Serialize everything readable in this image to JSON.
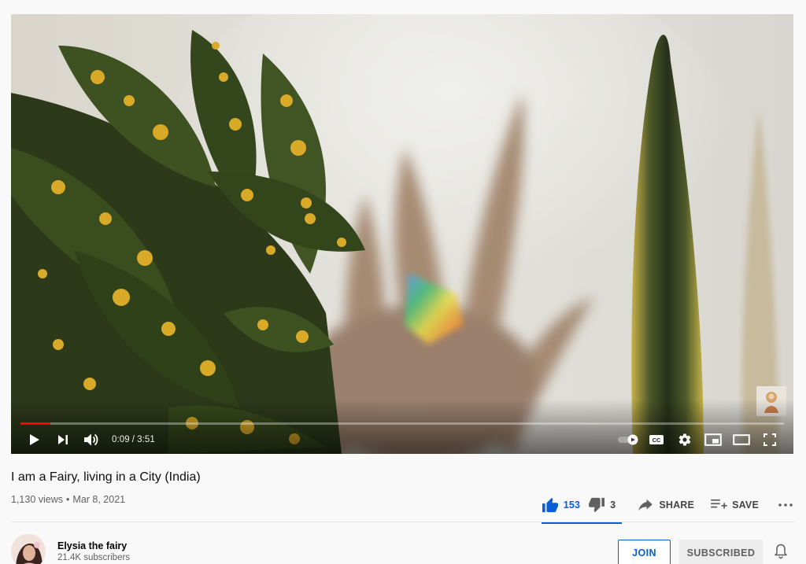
{
  "player": {
    "current_time": "0:09",
    "separator": "/",
    "duration": "3:51",
    "progress_played_fraction": 0.039,
    "progress_loaded_fraction": 0.039,
    "autoplay_on": true,
    "cc_label": "CC"
  },
  "icons": {
    "play": "play-icon",
    "next": "next-icon",
    "volume": "volume-icon",
    "autoplay": "autoplay-toggle-icon",
    "captions": "captions-icon",
    "settings": "gear-icon",
    "miniplayer": "miniplayer-icon",
    "theater": "theater-mode-icon",
    "fullscreen": "fullscreen-icon",
    "like": "thumbs-up-icon",
    "dislike": "thumbs-down-icon",
    "share": "share-icon",
    "save": "add-to-playlist-icon",
    "more": "more-horizontal-icon",
    "bell": "bell-icon"
  },
  "video": {
    "title": "I am a Fairy, living in a City (India)",
    "views": "1,130 views",
    "dot": "•",
    "date": "Mar 8, 2021"
  },
  "actions": {
    "like_count": "153",
    "dislike_count": "3",
    "share_label": "SHARE",
    "save_label": "SAVE"
  },
  "channel": {
    "name": "Elysia the fairy",
    "subscribers": "21.4K subscribers",
    "join_label": "JOIN",
    "subscribed_label": "SUBSCRIBED"
  },
  "colors": {
    "accent_blue": "#065fd4",
    "progress_red": "#ff0000",
    "secondary_text": "#606060"
  }
}
